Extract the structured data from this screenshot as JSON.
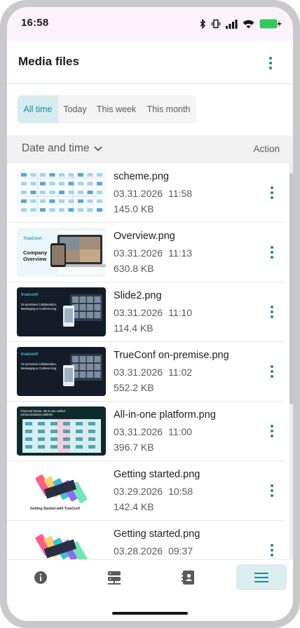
{
  "status_bar": {
    "time": "16:58",
    "icons": [
      "bluetooth-icon",
      "vibrate-icon",
      "signal-icon",
      "wifi-icon",
      "battery-charging-icon"
    ],
    "battery_color": "#34c759"
  },
  "header": {
    "title": "Media files",
    "menu_icon": "more-vertical-icon"
  },
  "filters": {
    "tabs": [
      {
        "label": "All time",
        "active": true
      },
      {
        "label": "Today",
        "active": false
      },
      {
        "label": "This week",
        "active": false
      },
      {
        "label": "This month",
        "active": false
      }
    ]
  },
  "columns": {
    "sort_label": "Date and time",
    "sort_icon": "chevron-down-icon",
    "action_label": "Action"
  },
  "files": [
    {
      "name": "scheme.png",
      "date": "03.31.2026",
      "time": "11:58",
      "size": "145.0 KB",
      "thumb": "scheme"
    },
    {
      "name": "Overview.png",
      "date": "03.31.2026",
      "time": "11:13",
      "size": "630.8 KB",
      "thumb": "overview"
    },
    {
      "name": "Slide2.png",
      "date": "03.31.2026",
      "time": "11:10",
      "size": "114.4 KB",
      "thumb": "slide"
    },
    {
      "name": "TrueConf on-premise.png",
      "date": "03.31.2026",
      "time": "11:02",
      "size": "552.2 KB",
      "thumb": "slide"
    },
    {
      "name": "All-in-one platform.png",
      "date": "03.31.2026",
      "time": "11:00",
      "size": "396.7 KB",
      "thumb": "platform"
    },
    {
      "name": "Getting started.png",
      "date": "03.29.2026",
      "time": "10:58",
      "size": "142.4 KB",
      "thumb": "started"
    },
    {
      "name": "Getting started.png",
      "date": "03.28.2026",
      "time": "09:37",
      "size": "",
      "thumb": "started"
    }
  ],
  "thumb_text": {
    "overview_brand": "TrueConf",
    "overview_line1": "Company",
    "overview_line2": "Overview",
    "slide_brand": "trueconf",
    "slide_line1": "On-premises Collaboration,",
    "slide_line2": "Messaging & Conferencing",
    "platform_line1": "TrueConf Server: all-in-one unified",
    "platform_line2": "communications platform",
    "started_caption": "Getting Started with TrueConf"
  },
  "bottom_nav": {
    "items": [
      {
        "icon": "info-icon",
        "active": false
      },
      {
        "icon": "server-icon",
        "active": false
      },
      {
        "icon": "contacts-book-icon",
        "active": false
      },
      {
        "icon": "menu-icon",
        "active": true
      }
    ]
  },
  "colors": {
    "accent": "#1f8a94",
    "active_tab_bg": "#d7ecee",
    "status_bar_bg": "#fbf3fb"
  }
}
